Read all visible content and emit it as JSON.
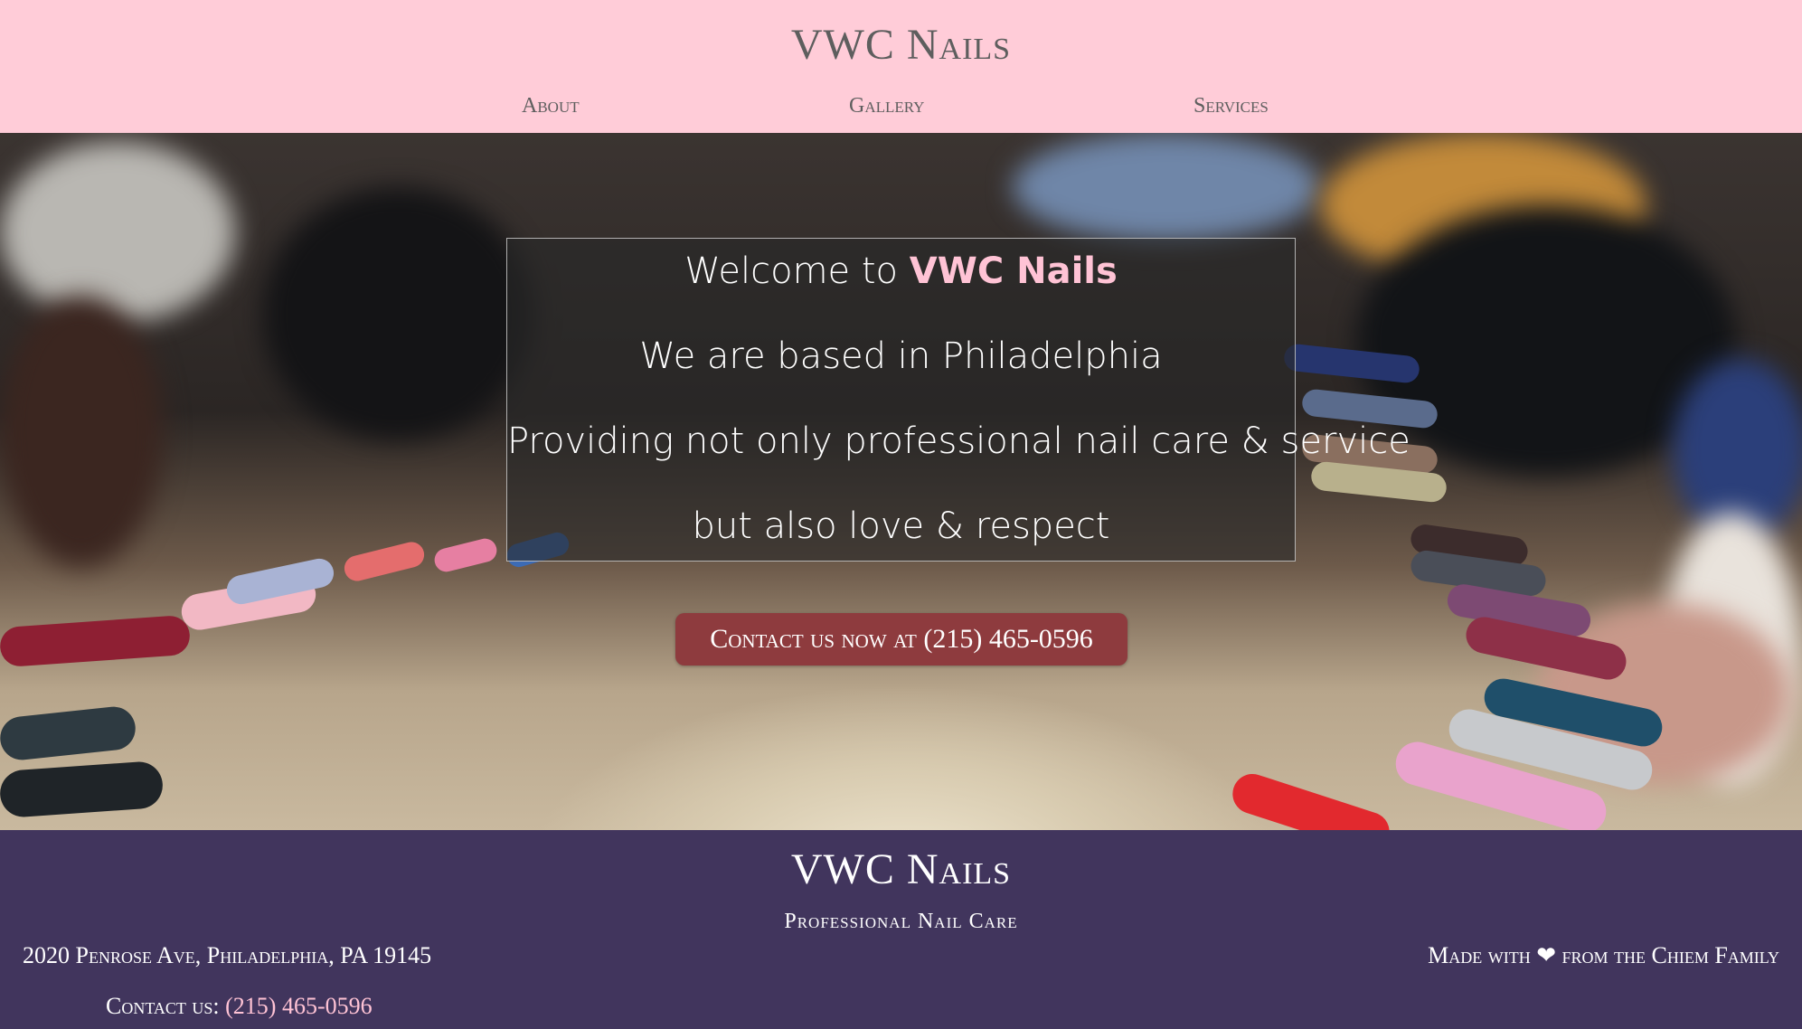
{
  "header": {
    "brand": "VWC Nails",
    "nav": {
      "about": "About",
      "gallery": "Gallery",
      "services": "Services"
    }
  },
  "hero": {
    "welcome_prefix": "Welcome to ",
    "welcome_brand": "VWC Nails",
    "line2": "We are based in Philadelphia",
    "line3": "Providing not only professional nail care & service",
    "line4": "but also love & respect",
    "cta": "Contact us now at (215) 465-0596"
  },
  "footer": {
    "brand": "VWC Nails",
    "tagline": "Professional Nail Care",
    "address": "2020 Penrose Ave, Philadelphia, PA 19145",
    "made_with": "Made with ❤ from the Chiem Family",
    "contact_label": "Contact us: ",
    "contact_phone": "(215) 465-0596"
  },
  "colors": {
    "header_bg": "#ffccd8",
    "footer_bg": "#41355d",
    "accent_pink": "#ffc3d5",
    "cta_bg": "#8e3b3e"
  }
}
